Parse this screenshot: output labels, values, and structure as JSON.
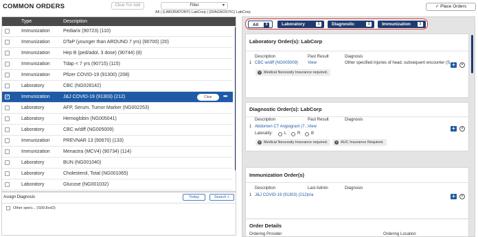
{
  "header": {
    "title": "COMMON ORDERS",
    "clear_for_add": "Clear For Add",
    "filter_label": "Filter",
    "breadcrumb": "All | (LABORATORY) LabCorp | (DIAGNOSTIC) LabCorp",
    "place_orders": "Place Orders"
  },
  "table": {
    "columns": [
      "Type",
      "Description"
    ],
    "rows": [
      {
        "type": "Immunization",
        "desc": "Pediarix (90723) (110)"
      },
      {
        "type": "Immunization",
        "desc": "DTaP (younger than AROUND 7 yrs) (90700) (20)"
      },
      {
        "type": "Immunization",
        "desc": "Hep B (ped/adol, 3 dose) (90744) (8)"
      },
      {
        "type": "Immunization",
        "desc": "Tdap < 7 yrs (90715) (115)"
      },
      {
        "type": "Immunization",
        "desc": "Pfizer COVID-19 (91300) (208)"
      },
      {
        "type": "Laboratory",
        "desc": "CBC (NG028142)"
      },
      {
        "type": "Immunization",
        "desc": "J&J COVID-19 (91303) (212)"
      },
      {
        "type": "Laboratory",
        "desc": "AFP, Serum, Tumor Marker (NG002253)"
      },
      {
        "type": "Laboratory",
        "desc": "Hemoglobin (NG005041)"
      },
      {
        "type": "Laboratory",
        "desc": "CBC w/diff (NG005009)"
      },
      {
        "type": "Immunization",
        "desc": "PREVNAR 13 (90670) (133)"
      },
      {
        "type": "Immunization",
        "desc": "Menactra (MCV4) (90734) (114)"
      },
      {
        "type": "Laboratory",
        "desc": "BUN (NG001040)"
      },
      {
        "type": "Laboratory",
        "desc": "Cholesterol, Total (NG001065)"
      },
      {
        "type": "Laboratory",
        "desc": "Glucose (NG001032)"
      }
    ],
    "selected_row_clear": "Clear",
    "more_glyph": "•••"
  },
  "assign": {
    "label": "Assign Diagnosis",
    "today": "Today",
    "search": "Search",
    "option": "Other speci... (S09.8xxD)"
  },
  "tabs": [
    {
      "label": "All",
      "count": "3"
    },
    {
      "label": "Laboratory",
      "count": "1"
    },
    {
      "label": "Diagnostic",
      "count": "1"
    },
    {
      "label": "Immunization",
      "count": "1"
    }
  ],
  "lab": {
    "title": "Laboratory Order(s): LabCorp",
    "col_desc": "Description",
    "col_past": "Past Result",
    "col_diag": "Diagnosis",
    "num": "1",
    "desc": "CBC w/diff (NG005009)",
    "past": "View",
    "diag": "Other specified injuries of head, subsequent encounter (S...",
    "note": "Medical Necessity Insurance required."
  },
  "diag": {
    "title": "Diagnostic Order(s): LabCorp",
    "col_desc": "Description",
    "col_past": "Past Result",
    "col_diag": "Diagnosis",
    "num": "1",
    "desc": "Abdomen CT Angiogram (7...",
    "past": "View",
    "laterality": "Laterality:",
    "l": "L",
    "r": "R",
    "b": "B",
    "note1": "Medical Necessity Insurance required.",
    "note2": "AUC Insurance Required."
  },
  "imm": {
    "title": "Immunization Order(s)",
    "col_desc": "Description",
    "col_admin": "Last Admin",
    "col_diag": "Diagnosis",
    "num": "1",
    "desc": "J&J COVID-19 (91303) (212)",
    "admin": "n/a"
  },
  "details": {
    "title": "Order Details",
    "provider": "Ordering Provider",
    "location": "Ordering Location"
  },
  "colors": {
    "header_dark": "#4a4a4a",
    "selected_blue": "#1f5aa6",
    "tab_navy": "#1d3b6e",
    "highlight_red": "#d93030"
  }
}
